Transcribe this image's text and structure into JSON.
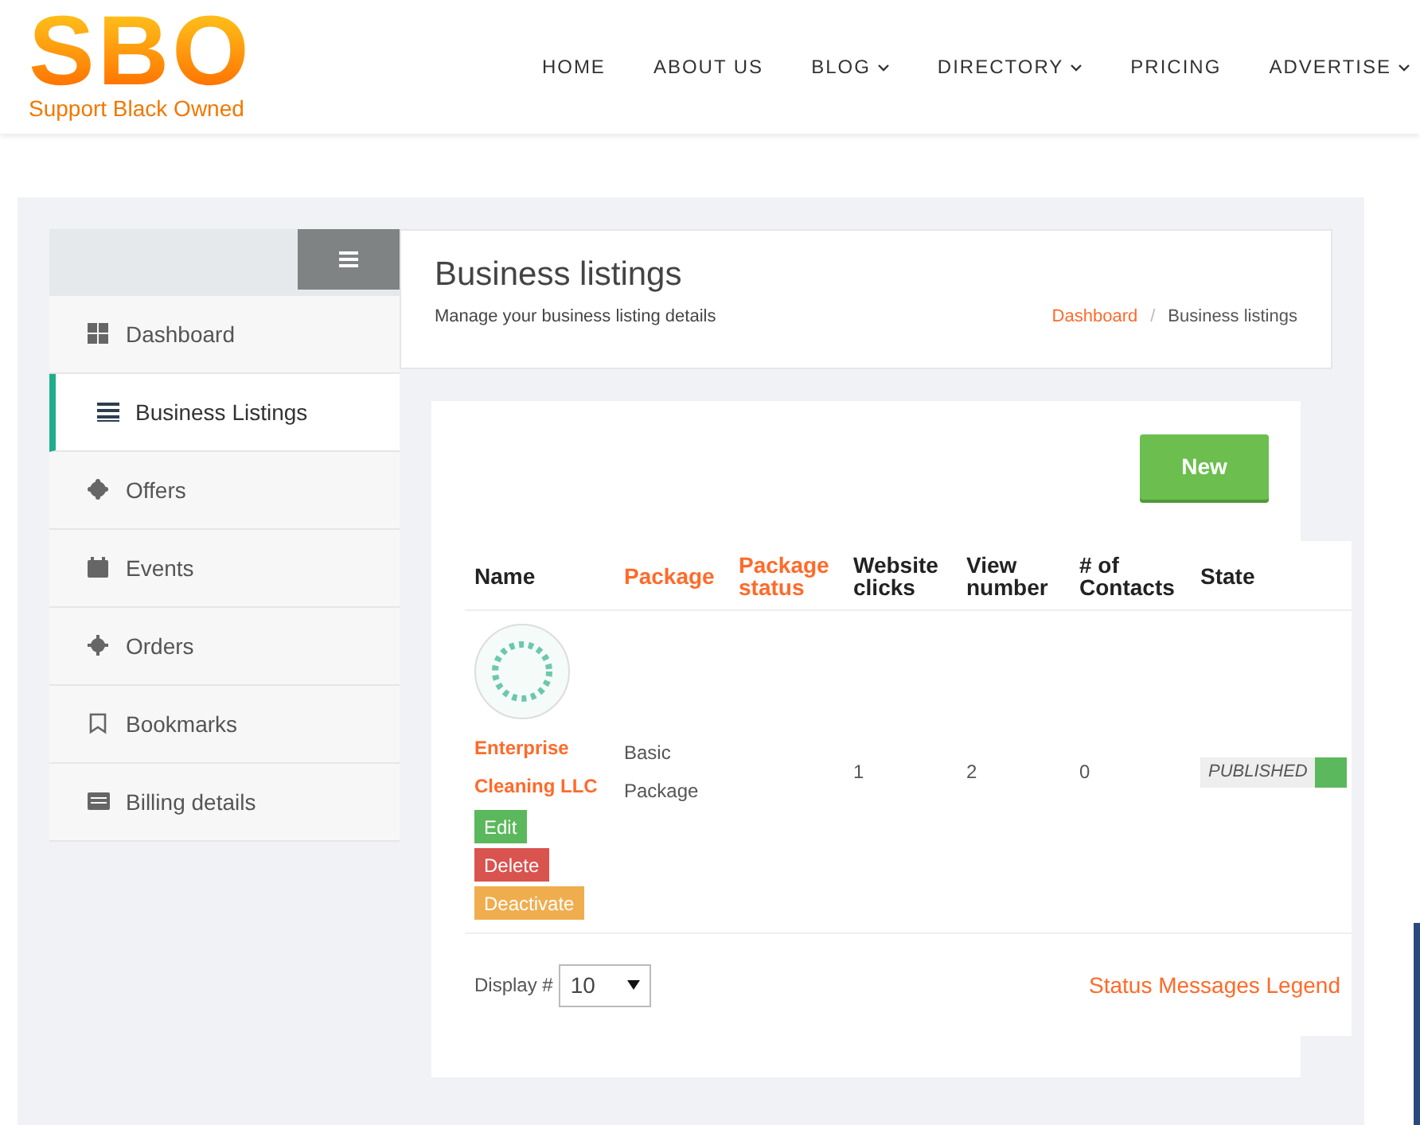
{
  "logo": {
    "mark": "SBO",
    "tagline": "Support Black Owned"
  },
  "nav": [
    {
      "label": "HOME",
      "dropdown": false
    },
    {
      "label": "ABOUT US",
      "dropdown": false
    },
    {
      "label": "BLOG",
      "dropdown": true
    },
    {
      "label": "DIRECTORY",
      "dropdown": true
    },
    {
      "label": "PRICING",
      "dropdown": false
    },
    {
      "label": "ADVERTISE",
      "dropdown": true
    }
  ],
  "sidebar": {
    "items": [
      {
        "label": "Dashboard",
        "selected": false
      },
      {
        "label": "Business Listings",
        "selected": true
      },
      {
        "label": "Offers",
        "selected": false
      },
      {
        "label": "Events",
        "selected": false
      },
      {
        "label": "Orders",
        "selected": false
      },
      {
        "label": "Bookmarks",
        "selected": false
      },
      {
        "label": "Billing details",
        "selected": false
      }
    ]
  },
  "page_header": {
    "title": "Business listings",
    "subtitle": "Manage your business listing details",
    "breadcrumb_separator": "/",
    "breadcrumb": [
      {
        "label": "Dashboard",
        "link": true
      },
      {
        "label": "Business listings",
        "link": false
      }
    ]
  },
  "new_button": "New",
  "table": {
    "columns": [
      {
        "label": "Name",
        "sortable": false
      },
      {
        "label": "Package",
        "sortable": true
      },
      {
        "label": "Package status",
        "sortable": true
      },
      {
        "label": "Website clicks",
        "sortable": false
      },
      {
        "label": "View number",
        "sortable": false
      },
      {
        "label": "# of Contacts",
        "sortable": false
      },
      {
        "label": "State",
        "sortable": false
      }
    ],
    "rows": [
      {
        "name": "Enterprise Cleaning LLC",
        "package": "Basic Package",
        "package_status": "",
        "website_clicks": "1",
        "view_number": "2",
        "contacts": "0",
        "state": "PUBLISHED",
        "actions": [
          {
            "label": "Edit",
            "kind": "edit"
          },
          {
            "label": "Delete",
            "kind": "delete"
          },
          {
            "label": "Deactivate",
            "kind": "deactivate"
          }
        ]
      }
    ]
  },
  "footer": {
    "display_label": "Display #",
    "display_value": "10",
    "legend_link": "Status Messages Legend"
  }
}
